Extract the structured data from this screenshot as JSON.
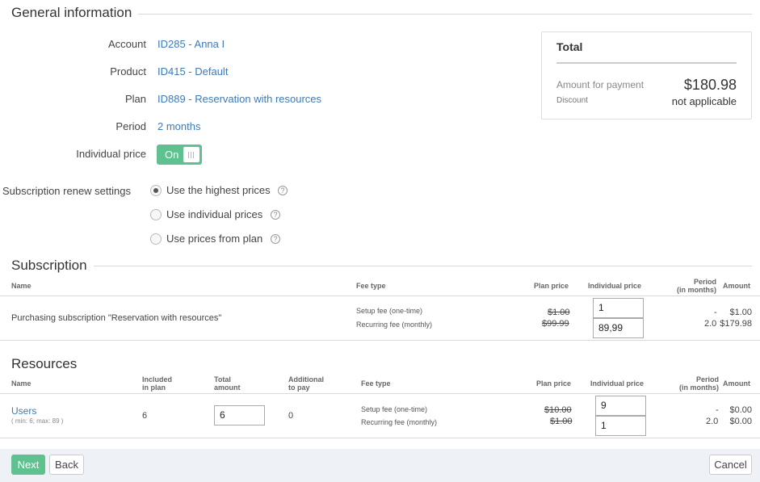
{
  "general": {
    "title": "General information",
    "fields": [
      {
        "label": "Account",
        "value": "ID285 - Anna I"
      },
      {
        "label": "Product",
        "value": "ID415 - Default"
      },
      {
        "label": "Plan",
        "value": "ID889 - Reservation with resources"
      },
      {
        "label": "Period",
        "value": "2 months"
      }
    ],
    "individual_price_label": "Individual price",
    "toggle_on": "On"
  },
  "renew": {
    "label": "Subscription renew settings",
    "options": [
      {
        "label": "Use the highest prices",
        "checked": true
      },
      {
        "label": "Use individual prices",
        "checked": false
      },
      {
        "label": "Use prices from plan",
        "checked": false
      }
    ],
    "help_glyph": "?"
  },
  "total": {
    "title": "Total",
    "amount_label": "Amount for payment",
    "amount_value": "$180.98",
    "discount_label": "Discount",
    "discount_value": "not applicable"
  },
  "subscription": {
    "title": "Subscription",
    "headers": {
      "name": "Name",
      "fee_type": "Fee type",
      "plan_price": "Plan price",
      "individual_price": "Individual price",
      "period_1": "Period",
      "period_2": "(in months)",
      "amount": "Amount"
    },
    "row": {
      "name": "Purchasing subscription \"Reservation with resources\"",
      "setup_fee": "Setup fee (one-time)",
      "recurring_fee": "Recurring fee (monthly)",
      "setup_plan_price": "$1.00",
      "recurring_plan_price": "$99.99",
      "setup_individual": "1",
      "recurring_individual": "89,99",
      "setup_period": "-",
      "recurring_period": "2.0",
      "setup_amount": "$1.00",
      "recurring_amount": "$179.98"
    }
  },
  "resources": {
    "title": "Resources",
    "headers": {
      "name": "Name",
      "included_1": "Included",
      "included_2": "in plan",
      "total_1": "Total",
      "total_2": "amount",
      "additional_1": "Additional",
      "additional_2": "to pay",
      "fee_type": "Fee type",
      "plan_price": "Plan price",
      "individual_price": "Individual price",
      "period_1": "Period",
      "period_2": "(in months)",
      "amount": "Amount"
    },
    "row": {
      "name": "Users",
      "limits": "( min: 6; max: 89 )",
      "included": "6",
      "total_amount": "6",
      "additional": "0",
      "setup_fee": "Setup fee (one-time)",
      "recurring_fee": "Recurring fee (monthly)",
      "setup_plan_price": "$10.00",
      "recurring_plan_price": "$1.00",
      "setup_individual": "9",
      "recurring_individual": "1",
      "setup_period": "-",
      "recurring_period": "2.0",
      "setup_amount": "$0.00",
      "recurring_amount": "$0.00"
    }
  },
  "footer": {
    "next": "Next",
    "back": "Back",
    "cancel": "Cancel"
  },
  "colors": {
    "accent": "#5fc18f",
    "link": "#3d7ab8"
  }
}
